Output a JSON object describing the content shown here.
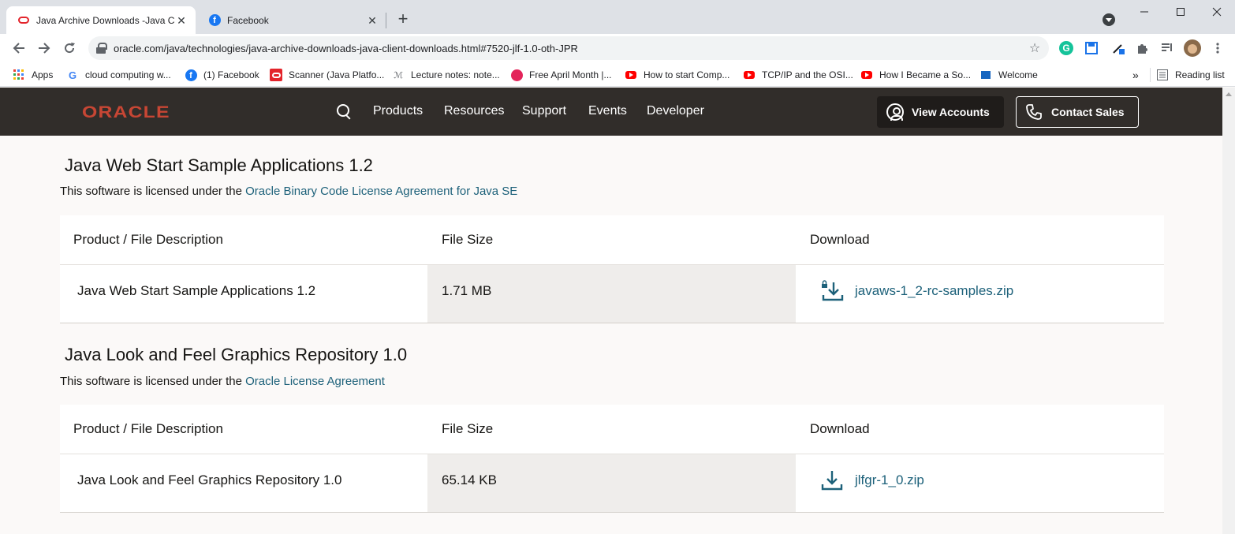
{
  "browser": {
    "tabs": [
      {
        "title": "Java Archive Downloads -Java Cli",
        "active": true,
        "favicon": "oracle-icon"
      },
      {
        "title": "Facebook",
        "active": false,
        "favicon": "facebook-icon"
      }
    ],
    "new_tab": "+",
    "url": "oracle.com/java/technologies/java-archive-downloads-java-client-downloads.html#7520-jlf-1.0-oth-JPR",
    "bookmarks": [
      {
        "label": "Apps",
        "icon": "apps-grid-icon"
      },
      {
        "label": "cloud computing w...",
        "icon": "google-icon"
      },
      {
        "label": "(1) Facebook",
        "icon": "facebook-icon"
      },
      {
        "label": "Scanner (Java Platfo...",
        "icon": "oracle-icon"
      },
      {
        "label": "Lecture notes: note...",
        "icon": "notes-icon"
      },
      {
        "label": "Free April Month |...",
        "icon": "music-icon"
      },
      {
        "label": "How to start Comp...",
        "icon": "youtube-icon"
      },
      {
        "label": "TCP/IP and the OSI...",
        "icon": "youtube-icon"
      },
      {
        "label": "How I Became a So...",
        "icon": "youtube-icon"
      },
      {
        "label": "Welcome",
        "icon": "site-icon"
      }
    ],
    "overflow": "»",
    "reading_list": "Reading list"
  },
  "header": {
    "logo": "ORACLE",
    "nav": [
      "Products",
      "Resources",
      "Support",
      "Events",
      "Developer"
    ],
    "view_accounts": "View Accounts",
    "contact_sales": "Contact Sales"
  },
  "sections": [
    {
      "title": "Java Web Start Sample Applications 1.2",
      "license_prefix": "This software is licensed under the ",
      "license_link": "Oracle Binary Code License Agreement for Java SE",
      "columns": [
        "Product / File Description",
        "File Size",
        "Download"
      ],
      "rows": [
        {
          "description": "Java Web Start Sample Applications 1.2",
          "size": "1.71 MB",
          "file": "javaws-1_2-rc-samples.zip",
          "locked": true
        }
      ]
    },
    {
      "title": "Java Look and Feel Graphics Repository 1.0",
      "license_prefix": "This software is licensed under the ",
      "license_link": "Oracle License Agreement",
      "columns": [
        "Product / File Description",
        "File Size",
        "Download"
      ],
      "rows": [
        {
          "description": "Java Look and Feel Graphics Repository 1.0",
          "size": "65.14 KB",
          "file": "jlfgr-1_0.zip",
          "locked": false
        }
      ]
    }
  ],
  "colors": {
    "header_bg": "#312d2a",
    "oracle_red": "#c74634",
    "link": "#1d617a",
    "page_bg": "#fbf9f8"
  }
}
